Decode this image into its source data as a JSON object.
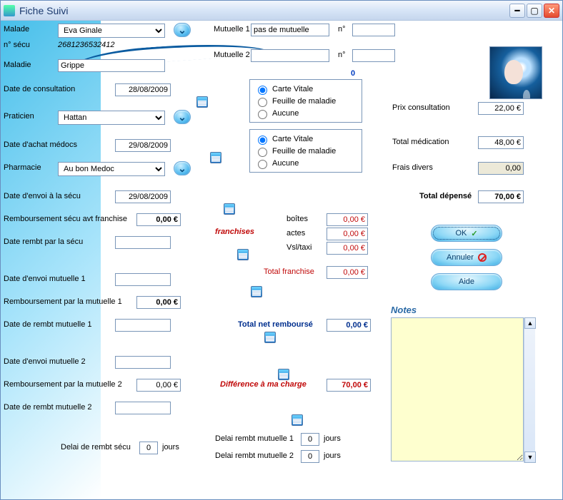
{
  "window": {
    "title": "Fiche Suivi"
  },
  "malade": {
    "label": "Malade",
    "value": "Eva Ginale"
  },
  "secu_no": {
    "label": "n° sécu",
    "value": "2681236532412"
  },
  "maladie": {
    "label": "Maladie",
    "value": "Grippe"
  },
  "date_consult": {
    "label": "Date de consultation",
    "value": "28/08/2009"
  },
  "praticien": {
    "label": "Praticien",
    "value": "Hattan"
  },
  "date_achat": {
    "label": "Date d'achat médocs",
    "value": "29/08/2009"
  },
  "pharmacie": {
    "label": "Pharmacie",
    "value": "Au bon Medoc"
  },
  "date_envoi_secu": {
    "label": "Date d'envoi à la sécu",
    "value": "29/08/2009"
  },
  "remb_secu_avt": {
    "label": "Remboursement sécu avt franchise",
    "value": "0,00 €"
  },
  "date_rembt_secu": {
    "label": "Date rembt par la sécu",
    "value": ""
  },
  "date_envoi_mut1": {
    "label": "Date d'envoi mutuelle 1",
    "value": ""
  },
  "remb_mut1": {
    "label": "Remboursement par la mutuelle 1",
    "value": "0,00 €"
  },
  "date_rembt_mut1": {
    "label": "Date de rembt mutuelle 1",
    "value": ""
  },
  "date_envoi_mut2": {
    "label": "Date d'envoi mutuelle 2",
    "value": ""
  },
  "remb_mut2": {
    "label": "Remboursement par la mutuelle 2",
    "value": "0,00 €"
  },
  "date_rembt_mut2": {
    "label": "Date de rembt mutuelle 2",
    "value": ""
  },
  "delai_secu": {
    "label": "Delai de rembt sécu",
    "value": "0",
    "unit": "jours"
  },
  "delai_mut1": {
    "label": "Delai rembt mutuelle 1",
    "value": "0",
    "unit": "jours"
  },
  "delai_mut2": {
    "label": "Delai rembt mutuelle 2",
    "value": "0",
    "unit": "jours"
  },
  "mut1": {
    "label": "Mutuelle 1",
    "value": "pas de mutuelle",
    "no_label": "n°",
    "no_value": ""
  },
  "mut2": {
    "label": "Mutuelle 2",
    "value": "",
    "no_label": "n°",
    "no_value": ""
  },
  "group_top": {
    "opt1": "Carte Vitale",
    "opt2": "Feuille de maladie",
    "opt3": "Aucune",
    "selected": "Carte Vitale",
    "header_zero": "0"
  },
  "group_bot": {
    "opt1": "Carte Vitale",
    "opt2": "Feuille de maladie",
    "opt3": "Aucune",
    "selected": "Carte Vitale"
  },
  "franchises": {
    "section": "franchises",
    "boites": {
      "label": "boîtes",
      "value": "0,00 €"
    },
    "actes": {
      "label": "actes",
      "value": "0,00 €"
    },
    "vsl": {
      "label": "Vsl/taxi",
      "value": "0,00 €"
    },
    "total": {
      "label": "Total franchise",
      "value": "0,00 €"
    }
  },
  "total_net": {
    "label": "Total net remboursé",
    "value": "0,00 €"
  },
  "diff_charge": {
    "label": "Différence à ma charge",
    "value": "70,00 €"
  },
  "right": {
    "prix": {
      "label": "Prix consultation",
      "value": "22,00 €"
    },
    "medic": {
      "label": "Total médication",
      "value": "48,00 €"
    },
    "frais": {
      "label": "Frais divers",
      "value": "0,00"
    },
    "depense": {
      "label": "Total dépensé",
      "value": "70,00 €"
    }
  },
  "buttons": {
    "ok": "OK",
    "annuler": "Annuler",
    "aide": "Aide"
  },
  "notes": {
    "title": "Notes"
  }
}
